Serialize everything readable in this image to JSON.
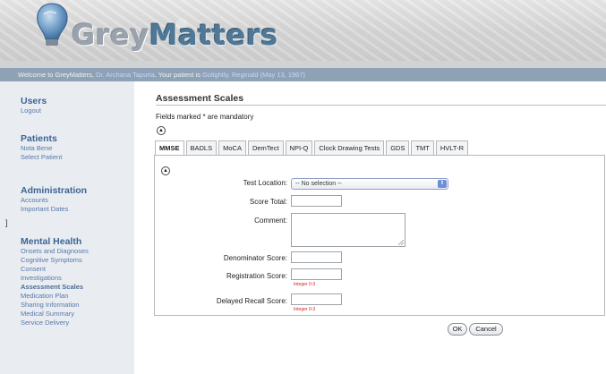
{
  "header": {
    "logo_part1": "Grey",
    "logo_part2": "Matters",
    "welcome_prefix": "Welcome to GreyMatters, ",
    "doctor_name": "Dr. Archana Tapuria",
    "welcome_middle": ". Your patient is ",
    "patient_name": "Golightly, Reginald (May 13, 1967)",
    "colors": {
      "bar": "#8fa2b5",
      "brand": "#4f7896"
    }
  },
  "sidebar": {
    "bracket": "]",
    "sections": [
      {
        "heading": "Users",
        "links": [
          "Logout"
        ]
      },
      {
        "heading": "Patients",
        "links": [
          "Nota Bene",
          "Select Patient"
        ]
      },
      {
        "heading": "Administration",
        "links": [
          "Accounts",
          "Important Dates"
        ]
      },
      {
        "heading": "Mental Health",
        "links": [
          "Onsets and Diagnoses",
          "Cognitive Symptoms",
          "Consent",
          "Investigations",
          "Assessment Scales",
          "Medication Plan",
          "Sharing Information",
          "Medical Summary",
          "Service Delivery"
        ],
        "active": "Assessment Scales"
      }
    ]
  },
  "main": {
    "title": "Assessment Scales",
    "mandatory_note": "Fields marked * are mandatory",
    "collapse_icon": "chevron-up-circle-icon",
    "tabs": [
      "MMSE",
      "BADLS",
      "MoCA",
      "DemTect",
      "NPI-Q",
      "Clock Drawing Tests",
      "GDS",
      "TMT",
      "HVLT-R"
    ],
    "active_tab": "MMSE",
    "form": {
      "test_location_label": "Test Location:",
      "test_location_value": "-- No selection --",
      "score_total_label": "Score Total:",
      "comment_label": "Comment:",
      "denominator_label": "Denominator Score:",
      "registration_label": "Registration Score:",
      "registration_hint": "Integer 0-3",
      "delayed_recall_label": "Delayed Recall Score:",
      "delayed_recall_hint": "Integer 0-3"
    },
    "buttons": {
      "ok": "OK",
      "cancel": "Cancel"
    }
  }
}
